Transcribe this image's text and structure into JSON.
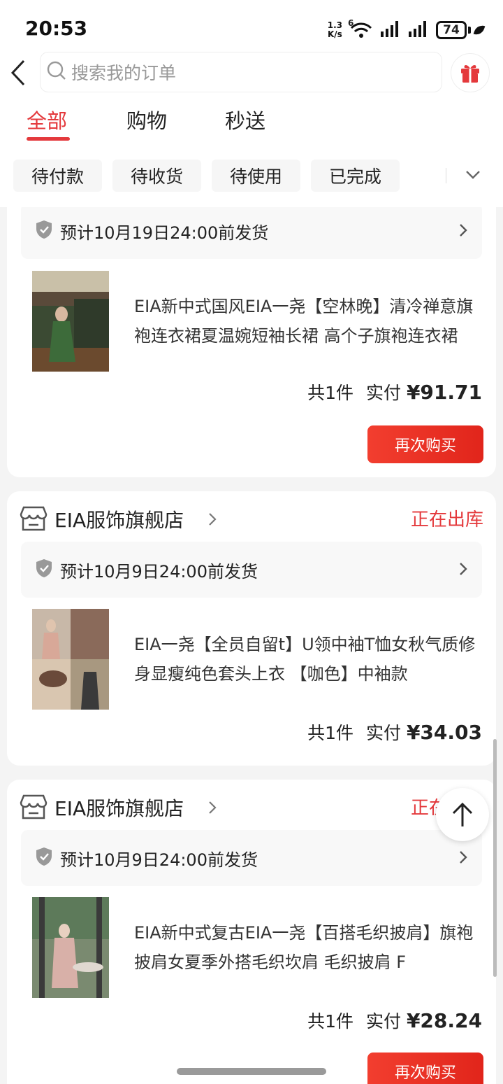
{
  "status_bar": {
    "time": "20:53",
    "net_speed_value": "1.3",
    "net_speed_unit": "K/s",
    "wifi_label": "6",
    "battery": "74"
  },
  "header": {
    "search_placeholder": "搜索我的订单"
  },
  "tabs": [
    {
      "label": "全部",
      "active": true
    },
    {
      "label": "购物",
      "active": false
    },
    {
      "label": "秒送",
      "active": false
    }
  ],
  "filters": [
    {
      "label": "待付款"
    },
    {
      "label": "待收货"
    },
    {
      "label": "待使用"
    },
    {
      "label": "已完成"
    }
  ],
  "orders": [
    {
      "shipping": "预计10月19日24:00前发货",
      "title": "EIA新中式国风EIA一尧【空林晚】清冷禅意旗袍连衣裙夏温婉短袖长裙 高个子旗袍连衣裙",
      "count": "共1件",
      "paid_label": "实付",
      "amount": "¥91.71",
      "button": "再次购买"
    },
    {
      "shop": "EIA服饰旗舰店",
      "status": "正在出库",
      "shipping": "预计10月9日24:00前发货",
      "title": "EIA一尧【全员自留t】U领中袖T恤女秋气质修身显瘦纯色套头上衣 【咖色】中袖款",
      "count": "共1件",
      "paid_label": "实付",
      "amount": "¥34.03"
    },
    {
      "shop": "EIA服饰旗舰店",
      "status": "正在出库",
      "shipping": "预计10月9日24:00前发货",
      "title": "EIA新中式复古EIA一尧【百搭毛织披肩】旗袍披肩女夏季外搭毛织坎肩 毛织披肩 F",
      "count": "共1件",
      "paid_label": "实付",
      "amount": "¥28.24",
      "button": "再次购买"
    }
  ],
  "colors": {
    "accent": "#e4393c",
    "button": "#e1251b"
  }
}
